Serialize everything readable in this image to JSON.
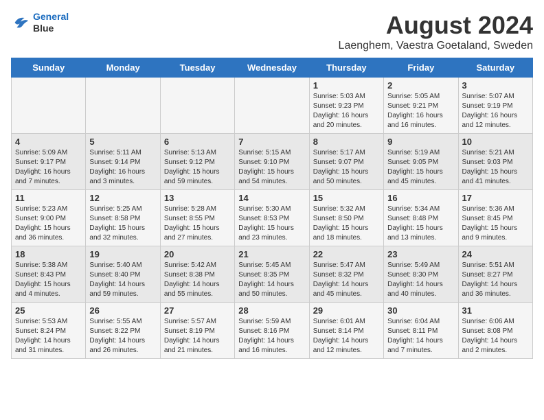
{
  "header": {
    "logo_line1": "General",
    "logo_line2": "Blue",
    "main_title": "August 2024",
    "subtitle": "Laenghem, Vaestra Goetaland, Sweden"
  },
  "days_of_week": [
    "Sunday",
    "Monday",
    "Tuesday",
    "Wednesday",
    "Thursday",
    "Friday",
    "Saturday"
  ],
  "weeks": [
    [
      {
        "day": "",
        "info": ""
      },
      {
        "day": "",
        "info": ""
      },
      {
        "day": "",
        "info": ""
      },
      {
        "day": "",
        "info": ""
      },
      {
        "day": "1",
        "info": "Sunrise: 5:03 AM\nSunset: 9:23 PM\nDaylight: 16 hours\nand 20 minutes."
      },
      {
        "day": "2",
        "info": "Sunrise: 5:05 AM\nSunset: 9:21 PM\nDaylight: 16 hours\nand 16 minutes."
      },
      {
        "day": "3",
        "info": "Sunrise: 5:07 AM\nSunset: 9:19 PM\nDaylight: 16 hours\nand 12 minutes."
      }
    ],
    [
      {
        "day": "4",
        "info": "Sunrise: 5:09 AM\nSunset: 9:17 PM\nDaylight: 16 hours\nand 7 minutes."
      },
      {
        "day": "5",
        "info": "Sunrise: 5:11 AM\nSunset: 9:14 PM\nDaylight: 16 hours\nand 3 minutes."
      },
      {
        "day": "6",
        "info": "Sunrise: 5:13 AM\nSunset: 9:12 PM\nDaylight: 15 hours\nand 59 minutes."
      },
      {
        "day": "7",
        "info": "Sunrise: 5:15 AM\nSunset: 9:10 PM\nDaylight: 15 hours\nand 54 minutes."
      },
      {
        "day": "8",
        "info": "Sunrise: 5:17 AM\nSunset: 9:07 PM\nDaylight: 15 hours\nand 50 minutes."
      },
      {
        "day": "9",
        "info": "Sunrise: 5:19 AM\nSunset: 9:05 PM\nDaylight: 15 hours\nand 45 minutes."
      },
      {
        "day": "10",
        "info": "Sunrise: 5:21 AM\nSunset: 9:03 PM\nDaylight: 15 hours\nand 41 minutes."
      }
    ],
    [
      {
        "day": "11",
        "info": "Sunrise: 5:23 AM\nSunset: 9:00 PM\nDaylight: 15 hours\nand 36 minutes."
      },
      {
        "day": "12",
        "info": "Sunrise: 5:25 AM\nSunset: 8:58 PM\nDaylight: 15 hours\nand 32 minutes."
      },
      {
        "day": "13",
        "info": "Sunrise: 5:28 AM\nSunset: 8:55 PM\nDaylight: 15 hours\nand 27 minutes."
      },
      {
        "day": "14",
        "info": "Sunrise: 5:30 AM\nSunset: 8:53 PM\nDaylight: 15 hours\nand 23 minutes."
      },
      {
        "day": "15",
        "info": "Sunrise: 5:32 AM\nSunset: 8:50 PM\nDaylight: 15 hours\nand 18 minutes."
      },
      {
        "day": "16",
        "info": "Sunrise: 5:34 AM\nSunset: 8:48 PM\nDaylight: 15 hours\nand 13 minutes."
      },
      {
        "day": "17",
        "info": "Sunrise: 5:36 AM\nSunset: 8:45 PM\nDaylight: 15 hours\nand 9 minutes."
      }
    ],
    [
      {
        "day": "18",
        "info": "Sunrise: 5:38 AM\nSunset: 8:43 PM\nDaylight: 15 hours\nand 4 minutes."
      },
      {
        "day": "19",
        "info": "Sunrise: 5:40 AM\nSunset: 8:40 PM\nDaylight: 14 hours\nand 59 minutes."
      },
      {
        "day": "20",
        "info": "Sunrise: 5:42 AM\nSunset: 8:38 PM\nDaylight: 14 hours\nand 55 minutes."
      },
      {
        "day": "21",
        "info": "Sunrise: 5:45 AM\nSunset: 8:35 PM\nDaylight: 14 hours\nand 50 minutes."
      },
      {
        "day": "22",
        "info": "Sunrise: 5:47 AM\nSunset: 8:32 PM\nDaylight: 14 hours\nand 45 minutes."
      },
      {
        "day": "23",
        "info": "Sunrise: 5:49 AM\nSunset: 8:30 PM\nDaylight: 14 hours\nand 40 minutes."
      },
      {
        "day": "24",
        "info": "Sunrise: 5:51 AM\nSunset: 8:27 PM\nDaylight: 14 hours\nand 36 minutes."
      }
    ],
    [
      {
        "day": "25",
        "info": "Sunrise: 5:53 AM\nSunset: 8:24 PM\nDaylight: 14 hours\nand 31 minutes."
      },
      {
        "day": "26",
        "info": "Sunrise: 5:55 AM\nSunset: 8:22 PM\nDaylight: 14 hours\nand 26 minutes."
      },
      {
        "day": "27",
        "info": "Sunrise: 5:57 AM\nSunset: 8:19 PM\nDaylight: 14 hours\nand 21 minutes."
      },
      {
        "day": "28",
        "info": "Sunrise: 5:59 AM\nSunset: 8:16 PM\nDaylight: 14 hours\nand 16 minutes."
      },
      {
        "day": "29",
        "info": "Sunrise: 6:01 AM\nSunset: 8:14 PM\nDaylight: 14 hours\nand 12 minutes."
      },
      {
        "day": "30",
        "info": "Sunrise: 6:04 AM\nSunset: 8:11 PM\nDaylight: 14 hours\nand 7 minutes."
      },
      {
        "day": "31",
        "info": "Sunrise: 6:06 AM\nSunset: 8:08 PM\nDaylight: 14 hours\nand 2 minutes."
      }
    ]
  ]
}
